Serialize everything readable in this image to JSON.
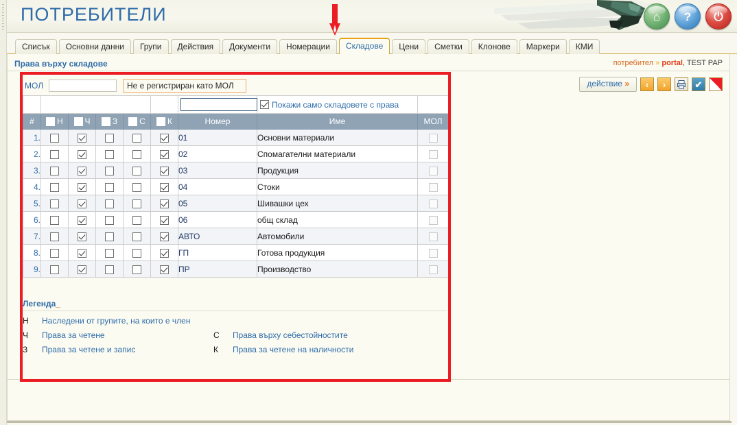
{
  "header": {
    "title": "ПОТРЕБИТЕЛИ",
    "icons": [
      {
        "name": "home-icon",
        "glyph": "⌂",
        "color": "#3e8b4c"
      },
      {
        "name": "help-icon",
        "glyph": "?",
        "color": "#2a74b4"
      },
      {
        "name": "power-icon",
        "glyph": "⏻",
        "color": "#b8211a"
      }
    ]
  },
  "tabs": [
    {
      "label": "Списък",
      "active": false
    },
    {
      "label": "Основни данни",
      "active": false
    },
    {
      "label": "Групи",
      "active": false
    },
    {
      "label": "Действия",
      "active": false
    },
    {
      "label": "Документи",
      "active": false
    },
    {
      "label": "Номерации",
      "active": false
    },
    {
      "label": "Складове",
      "active": true
    },
    {
      "label": "Цени",
      "active": false
    },
    {
      "label": "Сметки",
      "active": false
    },
    {
      "label": "Клонове",
      "active": false
    },
    {
      "label": "Маркери",
      "active": false
    },
    {
      "label": "КМИ",
      "active": false
    }
  ],
  "panel": {
    "title": "Права върху складове",
    "breadcrumb": {
      "prefix": "потребител",
      "separator": "»",
      "account": "portal",
      "comma": ",",
      "user": "TEST PAP"
    }
  },
  "toolbar": {
    "action_label": "действие",
    "action_chevron": "»",
    "buttons": [
      {
        "name": "prev-button",
        "glyph": "‹"
      },
      {
        "name": "next-button",
        "glyph": "›"
      },
      {
        "name": "print-button",
        "glyph": "▤"
      },
      {
        "name": "confirm-button",
        "glyph": "✔"
      },
      {
        "name": "cancel-button",
        "glyph": ""
      }
    ]
  },
  "mol_filter": {
    "label": "МОЛ",
    "input_value": "",
    "input_placeholder": "",
    "note": "Не е регистриран като МОЛ"
  },
  "grid_filter": {
    "number_value": "",
    "show_only_with_rights": {
      "label": "Покажи само складовете с права",
      "checked": true
    }
  },
  "grid": {
    "columns": [
      {
        "key": "idx",
        "label": "#",
        "type": "index"
      },
      {
        "key": "n",
        "label": "Н",
        "type": "checkbox-header"
      },
      {
        "key": "ch",
        "label": "Ч",
        "type": "checkbox-header"
      },
      {
        "key": "z",
        "label": "З",
        "type": "checkbox-header"
      },
      {
        "key": "s",
        "label": "С",
        "type": "checkbox-header"
      },
      {
        "key": "k",
        "label": "К",
        "type": "checkbox-header"
      },
      {
        "key": "code",
        "label": "Номер",
        "type": "text"
      },
      {
        "key": "name",
        "label": "Име",
        "type": "text"
      },
      {
        "key": "mol",
        "label": "МОЛ",
        "type": "checkbox-disabled"
      }
    ],
    "header_checks": {
      "n": false,
      "ch": false,
      "z": false,
      "s": false,
      "k": false
    },
    "rows": [
      {
        "idx": "1.",
        "n": false,
        "ch": true,
        "z": false,
        "s": false,
        "k": true,
        "code": "01",
        "name": "Основни материали",
        "mol": false
      },
      {
        "idx": "2.",
        "n": false,
        "ch": true,
        "z": false,
        "s": false,
        "k": true,
        "code": "02",
        "name": "Спомагателни материали",
        "mol": false
      },
      {
        "idx": "3.",
        "n": false,
        "ch": true,
        "z": false,
        "s": false,
        "k": true,
        "code": "03",
        "name": "Продукция",
        "mol": false
      },
      {
        "idx": "4.",
        "n": false,
        "ch": true,
        "z": false,
        "s": false,
        "k": true,
        "code": "04",
        "name": "Стоки",
        "mol": false
      },
      {
        "idx": "5.",
        "n": false,
        "ch": true,
        "z": false,
        "s": false,
        "k": true,
        "code": "05",
        "name": "Шивашки цех",
        "mol": false
      },
      {
        "idx": "6.",
        "n": false,
        "ch": true,
        "z": false,
        "s": false,
        "k": true,
        "code": "06",
        "name": "общ склад",
        "mol": false
      },
      {
        "idx": "7.",
        "n": false,
        "ch": true,
        "z": false,
        "s": false,
        "k": true,
        "code": "АВТО",
        "name": "Автомобили",
        "mol": false
      },
      {
        "idx": "8.",
        "n": false,
        "ch": true,
        "z": false,
        "s": false,
        "k": true,
        "code": "ГП",
        "name": "Готова продукция",
        "mol": false
      },
      {
        "idx": "9.",
        "n": false,
        "ch": true,
        "z": false,
        "s": false,
        "k": true,
        "code": "ПР",
        "name": "Производство",
        "mol": false
      }
    ]
  },
  "legend": {
    "title": "Легенда",
    "title_underscore": "_",
    "entries": [
      {
        "key": "Н",
        "value": "Наследени от групите, на които е член",
        "key2": "",
        "value2": ""
      },
      {
        "key": "Ч",
        "value": "Права за четене",
        "key2": "С",
        "value2": "Права върху себестойностите"
      },
      {
        "key": "З",
        "value": "Права за четене и запис",
        "key2": "К",
        "value2": "Права за четене на наличности"
      }
    ]
  },
  "annotations": {
    "arrow_color": "#ec1c24",
    "box_color": "#ec1c24",
    "arrow_target": "Складове"
  }
}
